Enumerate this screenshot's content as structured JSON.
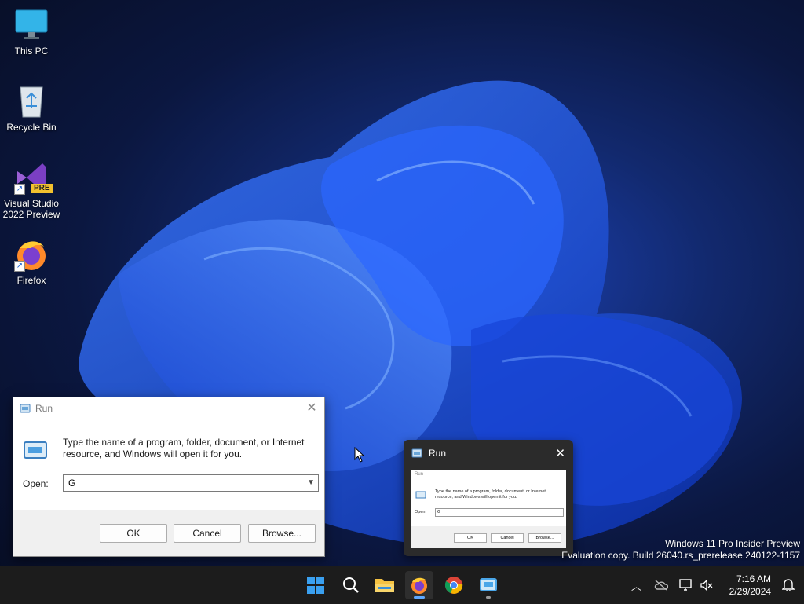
{
  "desktop": {
    "icons": [
      {
        "label": "This PC",
        "icon": "monitor-icon"
      },
      {
        "label": "Recycle Bin",
        "icon": "recycle-bin-icon"
      },
      {
        "label": "Visual Studio\n2022 Preview",
        "icon": "visual-studio-icon",
        "badge": "PRE"
      },
      {
        "label": "Firefox",
        "icon": "firefox-icon"
      }
    ]
  },
  "run_dialog": {
    "title": "Run",
    "description": "Type the name of a program, folder, document, or Internet resource, and Windows will open it for you.",
    "open_label": "Open:",
    "open_value": "G",
    "ok_label": "OK",
    "cancel_label": "Cancel",
    "browse_label": "Browse..."
  },
  "thumbnail": {
    "title": "Run"
  },
  "watermark": {
    "line1": "Windows 11 Pro Insider Preview",
    "line2": "Evaluation copy. Build 26040.rs_prerelease.240122-1157"
  },
  "taskbar": {
    "apps": [
      "start-icon",
      "search-icon",
      "file-explorer-icon",
      "firefox-icon",
      "chrome-icon",
      "run-icon"
    ],
    "clock": {
      "time": "7:16 AM",
      "date": "2/29/2024"
    }
  },
  "colors": {
    "accent": "#0078d4",
    "taskbar": "#1c1c1c",
    "wallpaper": "#12296e"
  }
}
